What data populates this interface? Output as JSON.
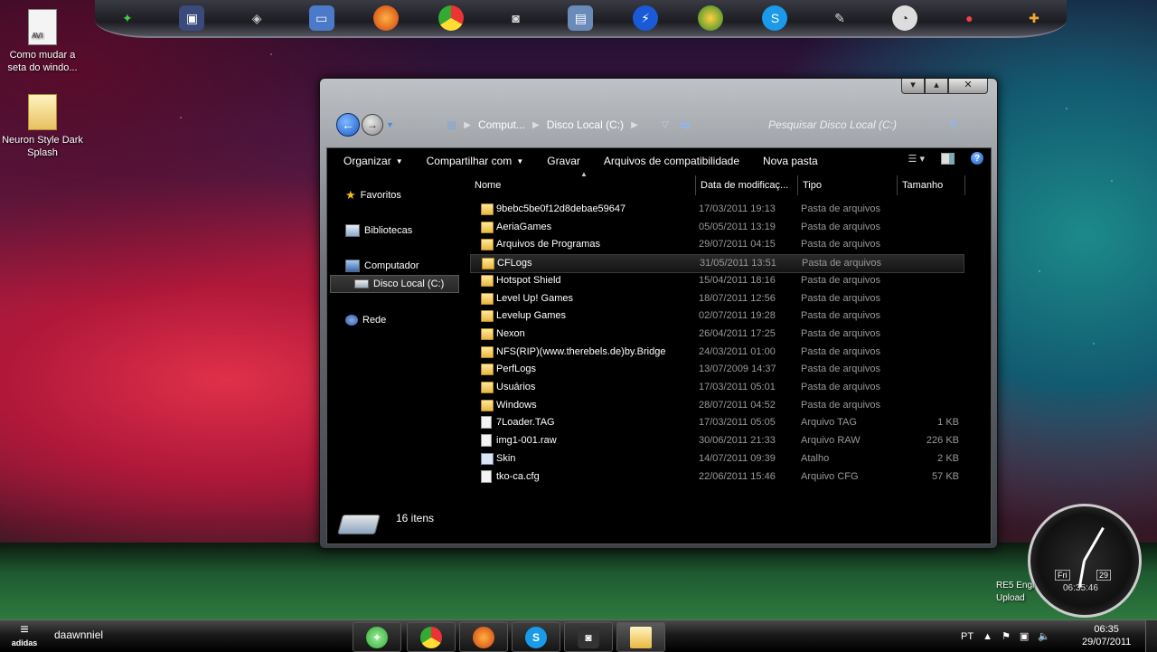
{
  "desktop": {
    "icons": [
      {
        "label": "Como mudar a seta do windo...",
        "type_badge": "AVI"
      },
      {
        "label": "Neuron Style Dark Splash"
      }
    ],
    "gadget_text": [
      "RE5 Engi",
      "Upload"
    ],
    "clock": {
      "day": "Fri",
      "date": "29",
      "time": "06:35:46"
    }
  },
  "dock": {
    "items": [
      "app-1",
      "app-2",
      "app-3",
      "app-4",
      "firefox",
      "chrome",
      "camera",
      "app-8",
      "app-9",
      "app-10",
      "skype",
      "app-12",
      "app-13",
      "app-14",
      "app-15"
    ]
  },
  "window": {
    "breadcrumbs": [
      "Comput...",
      "Disco Local (C:)"
    ],
    "search_placeholder": "Pesquisar Disco Local (C:)",
    "toolbar": {
      "organize": "Organizar",
      "share": "Compartilhar com",
      "burn": "Gravar",
      "compat": "Arquivos de compatibilidade",
      "new_folder": "Nova pasta"
    },
    "nav": {
      "favorites": "Favoritos",
      "libraries": "Bibliotecas",
      "computer": "Computador",
      "local_disk": "Disco Local (C:)",
      "network": "Rede"
    },
    "columns": {
      "name": "Nome",
      "date": "Data de modificaç...",
      "type": "Tipo",
      "size": "Tamanho"
    },
    "files": [
      {
        "name": "9bebc5be0f12d8debae59647",
        "date": "17/03/2011 19:13",
        "type": "Pasta de arquivos",
        "size": "",
        "kind": "folder"
      },
      {
        "name": "AeriaGames",
        "date": "05/05/2011 13:19",
        "type": "Pasta de arquivos",
        "size": "",
        "kind": "folder"
      },
      {
        "name": "Arquivos de Programas",
        "date": "29/07/2011 04:15",
        "type": "Pasta de arquivos",
        "size": "",
        "kind": "folder"
      },
      {
        "name": "CFLogs",
        "date": "31/05/2011 13:51",
        "type": "Pasta de arquivos",
        "size": "",
        "kind": "folder"
      },
      {
        "name": "Hotspot Shield",
        "date": "15/04/2011 18:16",
        "type": "Pasta de arquivos",
        "size": "",
        "kind": "folder"
      },
      {
        "name": "Level Up! Games",
        "date": "18/07/2011 12:56",
        "type": "Pasta de arquivos",
        "size": "",
        "kind": "folder"
      },
      {
        "name": "Levelup Games",
        "date": "02/07/2011 19:28",
        "type": "Pasta de arquivos",
        "size": "",
        "kind": "folder"
      },
      {
        "name": "Nexon",
        "date": "26/04/2011 17:25",
        "type": "Pasta de arquivos",
        "size": "",
        "kind": "folder"
      },
      {
        "name": "NFS(RIP)(www.therebels.de)by.Bridge",
        "date": "24/03/2011 01:00",
        "type": "Pasta de arquivos",
        "size": "",
        "kind": "folder"
      },
      {
        "name": "PerfLogs",
        "date": "13/07/2009 14:37",
        "type": "Pasta de arquivos",
        "size": "",
        "kind": "folder"
      },
      {
        "name": "Usuários",
        "date": "17/03/2011 05:01",
        "type": "Pasta de arquivos",
        "size": "",
        "kind": "folder"
      },
      {
        "name": "Windows",
        "date": "28/07/2011 04:52",
        "type": "Pasta de arquivos",
        "size": "",
        "kind": "folder"
      },
      {
        "name": "7Loader.TAG",
        "date": "17/03/2011 05:05",
        "type": "Arquivo TAG",
        "size": "1 KB",
        "kind": "file"
      },
      {
        "name": "img1-001.raw",
        "date": "30/06/2011 21:33",
        "type": "Arquivo RAW",
        "size": "226 KB",
        "kind": "file"
      },
      {
        "name": "Skin",
        "date": "14/07/2011 09:39",
        "type": "Atalho",
        "size": "2 KB",
        "kind": "shortcut"
      },
      {
        "name": "tko-ca.cfg",
        "date": "22/06/2011 15:46",
        "type": "Arquivo CFG",
        "size": "57 KB",
        "kind": "file"
      }
    ],
    "highlighted_index": 3,
    "status": "16 itens"
  },
  "taskbar": {
    "start_label": "adidas",
    "user": "daawnniel",
    "buttons": [
      "messenger",
      "chrome",
      "firefox",
      "skype",
      "camera",
      "explorer"
    ],
    "tray": {
      "lang": "PT",
      "time": "06:35",
      "date": "29/07/2011"
    }
  }
}
